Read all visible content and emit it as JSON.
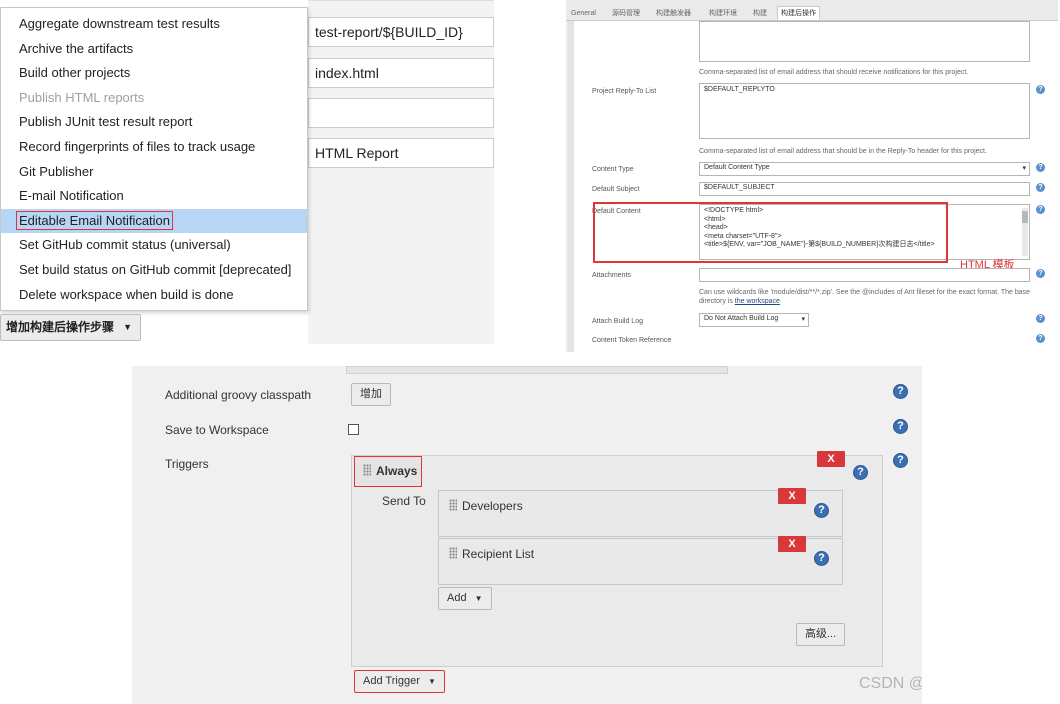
{
  "panel1": {
    "fields": [
      "test-report/${BUILD_ID}",
      "index.html",
      "",
      "HTML Report"
    ],
    "menu_items": [
      {
        "label": "Aggregate downstream test results",
        "state": "normal"
      },
      {
        "label": "Archive the artifacts",
        "state": "normal"
      },
      {
        "label": "Build other projects",
        "state": "normal"
      },
      {
        "label": "Publish HTML reports",
        "state": "disabled"
      },
      {
        "label": "Publish JUnit test result report",
        "state": "normal"
      },
      {
        "label": "Record fingerprints of files to track usage",
        "state": "normal"
      },
      {
        "label": "Git Publisher",
        "state": "normal"
      },
      {
        "label": "E-mail Notification",
        "state": "normal"
      },
      {
        "label": "Editable Email Notification",
        "state": "selected"
      },
      {
        "label": "Set GitHub commit status (universal)",
        "state": "normal"
      },
      {
        "label": "Set build status on GitHub commit [deprecated]",
        "state": "normal"
      },
      {
        "label": "Delete workspace when build is done",
        "state": "normal"
      }
    ],
    "add_step_button": "增加构建后操作步骤",
    "caret_icon": "▼"
  },
  "panel2": {
    "tabs": [
      "General",
      "源码管理",
      "构建触发器",
      "构建环境",
      "构建",
      "构建后操作"
    ],
    "active_tab": "构建后操作",
    "recipient_help": "Comma-separated list of email address that should receive notifications for this project.",
    "reply_to_label": "Project Reply-To List",
    "reply_to_value": "$DEFAULT_REPLYTO",
    "reply_to_help": "Comma-separated list of email address that should be in the Reply-To header for this project.",
    "content_type_label": "Content Type",
    "content_type_value": "Default Content Type",
    "subject_label": "Default Subject",
    "subject_value": "$DEFAULT_SUBJECT",
    "content_label": "Default Content",
    "content_lines": [
      "<!DOCTYPE html>",
      "<html>",
      "<head>",
      "<meta charset=\"UTF-8\">",
      "<title>${ENV, var=\"JOB_NAME\"}-第${BUILD_NUMBER}次构建日志</title>"
    ],
    "annotation": "HTML 模板",
    "attachments_label": "Attachments",
    "attachments_help_1": "Can use wildcards like 'module/dist/**/*.zip'. See the @includes of Ant fileset for the exact format. The base",
    "attachments_help_2": "directory is ",
    "attachments_help_link": "the workspace",
    "attach_log_label": "Attach Build Log",
    "attach_log_value": "Do Not Attach Build Log",
    "content_token_label": "Content Token Reference",
    "help_icon": "?"
  },
  "panel3": {
    "classpath_label": "Additional groovy classpath",
    "classpath_button": "增加",
    "save_workspace_label": "Save to Workspace",
    "triggers_label": "Triggers",
    "trigger_name": "Always",
    "send_to_label": "Send To",
    "recipients": [
      "Developers",
      "Recipient List"
    ],
    "delete_label": "X",
    "add_button": "Add",
    "advanced_button": "高级...",
    "add_trigger_button": "Add Trigger",
    "help_icon": "?",
    "caret_icon": "▼",
    "watermark": "CSDN @"
  },
  "colors": {
    "highlight_red": "#e0333a",
    "selected_blue": "#b7d5f5",
    "delete_red": "#d9383a",
    "help_blue": "#3a6fb0"
  }
}
